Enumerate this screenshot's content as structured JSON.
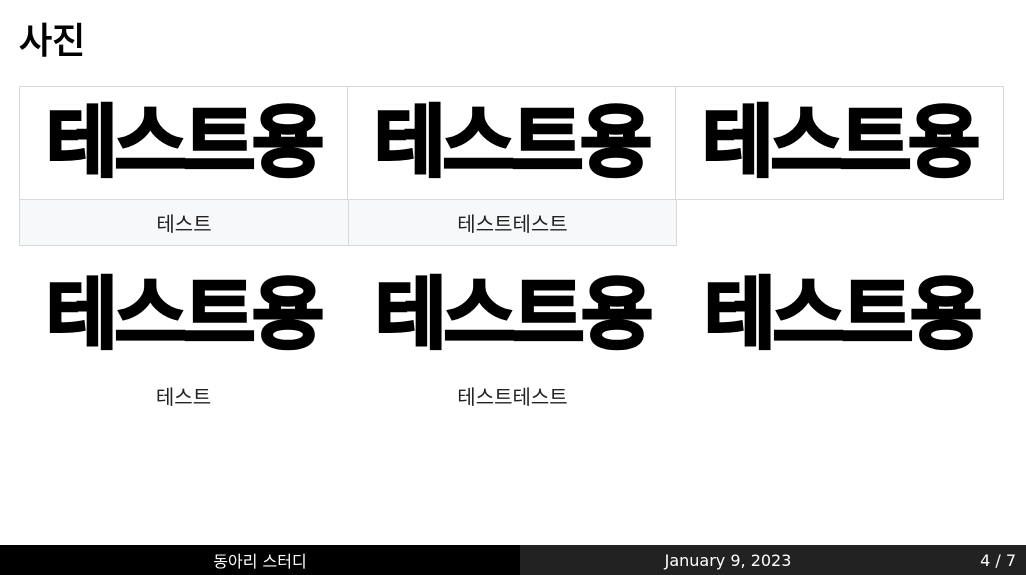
{
  "slide": {
    "title": "사진"
  },
  "gallery_top": {
    "images": [
      {
        "text": "테스트용"
      },
      {
        "text": "테스트용"
      },
      {
        "text": "테스트용"
      }
    ],
    "captions": [
      "테스트",
      "테스트테스트"
    ]
  },
  "gallery_bottom": {
    "images": [
      {
        "text": "테스트용"
      },
      {
        "text": "테스트용"
      },
      {
        "text": "테스트용"
      }
    ],
    "captions": [
      "테스트",
      "테스트테스트"
    ]
  },
  "footer": {
    "title": "동아리 스터디",
    "date": "January 9, 2023",
    "page": "4 / 7"
  }
}
